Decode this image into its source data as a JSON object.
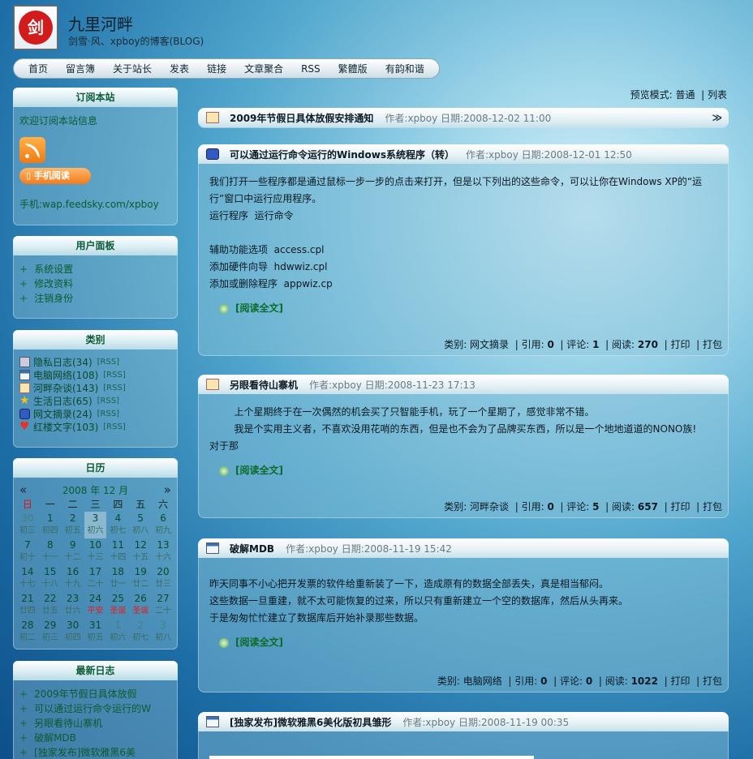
{
  "site": {
    "logo_glyph": "剑",
    "title": "九里河畔",
    "subtitle": "剑雪·风、xpboy的博客(BLOG)"
  },
  "nav": [
    "首页",
    "留言簿",
    "关于站长",
    "发表",
    "链接",
    "文章聚合",
    "RSS",
    "繁體版",
    "有韵和谐"
  ],
  "view_mode": {
    "label": "预览模式:",
    "normal": "普通",
    "list": "列表"
  },
  "subscribe": {
    "title": "订阅本站",
    "welcome": "欢迎订阅本站信息",
    "mobile_btn": "手机阅读",
    "mobile_url": "手机:wap.feedsky.com/xpboy"
  },
  "user_panel": {
    "title": "用户面板",
    "items": [
      "系统设置",
      "修改资料",
      "注销身份"
    ]
  },
  "categories": {
    "title": "类别",
    "items": [
      {
        "name": "隐私日志(34)",
        "rss": "[RSS]",
        "icon": "lock-icon"
      },
      {
        "name": "电脑网络(108)",
        "rss": "[RSS]",
        "icon": "window-icon"
      },
      {
        "name": "河畔杂谈(143)",
        "rss": "[RSS]",
        "icon": "home-icon"
      },
      {
        "name": "生活日志(65)",
        "rss": "[RSS]",
        "icon": "star-icon"
      },
      {
        "name": "网文摘录(24)",
        "rss": "[RSS]",
        "icon": "book-icon"
      },
      {
        "name": "红楼文字(103)",
        "rss": "[RSS]",
        "icon": "heart-icon"
      }
    ]
  },
  "calendar": {
    "title": "日历",
    "prev": "«",
    "next": "»",
    "month_label": "2008 年 12 月",
    "weekdays": [
      "日",
      "一",
      "二",
      "三",
      "四",
      "五",
      "六"
    ],
    "rows": [
      [
        "30",
        "1",
        "2",
        "3",
        "4",
        "5",
        "6"
      ],
      [
        "初三",
        "初四",
        "初五",
        "初六",
        "初七",
        "初八",
        "初九"
      ],
      [
        "7",
        "8",
        "9",
        "10",
        "11",
        "12",
        "13"
      ],
      [
        "初十",
        "十一",
        "十二",
        "十三",
        "十四",
        "十五",
        "十六"
      ],
      [
        "14",
        "15",
        "16",
        "17",
        "18",
        "19",
        "20"
      ],
      [
        "十七",
        "十八",
        "十九",
        "二十",
        "廿一",
        "廿二",
        "廿三"
      ],
      [
        "21",
        "22",
        "23",
        "24",
        "25",
        "26",
        "27"
      ],
      [
        "廿四",
        "廿五",
        "廿六",
        "平安",
        "圣诞",
        "圣诞",
        "二十"
      ],
      [
        "28",
        "29",
        "30",
        "31",
        "1",
        "2",
        "3"
      ],
      [
        "初二",
        "初三",
        "初四",
        "初五",
        "初六",
        "初七",
        "初八"
      ]
    ]
  },
  "latest": {
    "title": "最新日志",
    "items": [
      "2009年节假日具体放假",
      "可以通过运行命令运行的W",
      "另眼看待山寨机",
      "破解MDB",
      "[独家发布]微软雅黑6美"
    ]
  },
  "posts": [
    {
      "title": "2009年节假日具体放假安排通知",
      "meta": "作者:xpboy 日期:2008-12-02 11:00",
      "collapse": "≫",
      "icon": "home-icon"
    },
    {
      "title": "可以通过运行命令运行的Windows系统程序（转）",
      "meta": "作者:xpboy 日期:2008-12-01 12:50",
      "icon": "book-icon",
      "lines": [
        "我们打开一些程序都是通过鼠标一步一步的点击来打开，但是以下列出的这些命令，可以让你在Windows XP的“运",
        "行”窗口中运行应用程序。",
        "运行程序  运行命令",
        "",
        "辅助功能选项  access.cpl",
        "添加硬件向导  hdwwiz.cpl",
        "添加或删除程序  appwiz.cp"
      ],
      "readmore": "[阅读全文]",
      "footer": {
        "category": "类别: 网文摘录",
        "quote_label": "引用:",
        "quote": "0",
        "comment_label": "评论:",
        "comment": "1",
        "read_label": "阅读:",
        "read": "270",
        "print": "打印",
        "pack": "打包"
      }
    },
    {
      "title": "另眼看待山寨机",
      "meta": "作者:xpboy 日期:2008-11-23 17:13",
      "icon": "home-icon",
      "lines": [
        "        上个星期终于在一次偶然的机会买了只智能手机，玩了一个星期了，感觉非常不错。",
        "        我是个实用主义者，不喜欢没用花哨的东西，但是也不会为了品牌买东西，所以是一个地地道道的NONO族!",
        "对于那"
      ],
      "readmore": "[阅读全文]",
      "footer": {
        "category": "类别: 河畔杂谈",
        "quote_label": "引用:",
        "quote": "0",
        "comment_label": "评论:",
        "comment": "5",
        "read_label": "阅读:",
        "read": "657",
        "print": "打印",
        "pack": "打包"
      }
    },
    {
      "title": "破解MDB",
      "meta": "作者:xpboy 日期:2008-11-19 15:42",
      "icon": "window-icon",
      "lines": [
        "昨天同事不小心把开发票的软件给重新装了一下，造成原有的数据全部丢失，真是相当郁闷。",
        "这些数据一旦重建，就不太可能恢复的过来，所以只有重新建立一个空的数据库，然后从头再来。",
        "于是匆匆忙忙建立了数据库后开始补录那些数据。"
      ],
      "readmore": "[阅读全文]",
      "footer": {
        "category": "类别: 电脑网络",
        "quote_label": "引用:",
        "quote": "0",
        "comment_label": "评论:",
        "comment": "0",
        "read_label": "阅读:",
        "read": "1022",
        "print": "打印",
        "pack": "打包"
      }
    },
    {
      "title": "[独家发布]微软雅黑6美化版初具雏形",
      "meta": "作者:xpboy 日期:2008-11-19 00:35",
      "icon": "window-icon"
    }
  ],
  "colors": {
    "accent_green": "#0d5b2d",
    "red": "#e31c1c",
    "rss_orange": "#f07a10"
  }
}
